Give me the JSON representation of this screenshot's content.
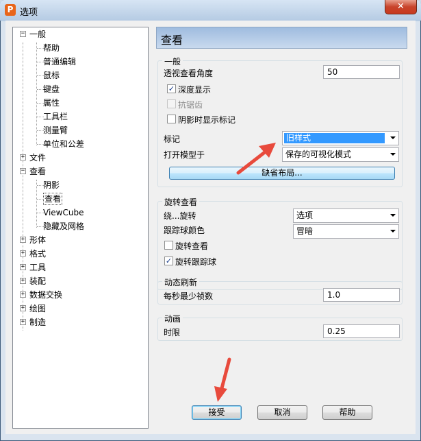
{
  "window": {
    "title": "选项",
    "app_icon_letter": "P",
    "close_glyph": "✕"
  },
  "tree": {
    "items": [
      {
        "label": "一般",
        "expander": "−"
      },
      {
        "label": "帮助"
      },
      {
        "label": "普通编辑"
      },
      {
        "label": "鼠标"
      },
      {
        "label": "键盘"
      },
      {
        "label": "属性"
      },
      {
        "label": "工具栏"
      },
      {
        "label": "测量臂"
      },
      {
        "label": "单位和公差"
      },
      {
        "label": "文件",
        "expander": "+"
      },
      {
        "label": "查看",
        "expander": "−"
      },
      {
        "label": "阴影"
      },
      {
        "label": "查看"
      },
      {
        "label": "ViewCube"
      },
      {
        "label": "隐藏及网格"
      },
      {
        "label": "形体",
        "expander": "+"
      },
      {
        "label": "格式",
        "expander": "+"
      },
      {
        "label": "工具",
        "expander": "+"
      },
      {
        "label": "装配",
        "expander": "+"
      },
      {
        "label": "数据交换",
        "expander": "+"
      },
      {
        "label": "绘图",
        "expander": "+"
      },
      {
        "label": "制造",
        "expander": "+"
      }
    ]
  },
  "panel": {
    "title": "查看",
    "general": {
      "title": "一般",
      "perspective_label": "透视查看角度",
      "perspective_value": "50",
      "depth_display_label": "深度显示",
      "depth_display_checked": true,
      "antialias_label": "抗锯齿",
      "antialias_checked": false,
      "shadow_marker_label": "阴影时显示标记",
      "shadow_marker_checked": false,
      "marker_label": "标记",
      "marker_value": "旧样式",
      "open_model_label": "打开模型于",
      "open_model_value": "保存的可视化模式",
      "default_layout_button": "缺省布局..."
    },
    "rotate": {
      "title": "旋转查看",
      "around_label": "绕...旋转",
      "around_value": "选项",
      "trackball_color_label": "跟踪球颜色",
      "trackball_color_value": "冒暗",
      "rotate_view_label": "旋转查看",
      "rotate_view_checked": false,
      "rotate_trackball_label": "旋转跟踪球",
      "rotate_trackball_checked": true
    },
    "refresh": {
      "title": "动态刷新",
      "min_fps_label": "每秒最少祯数",
      "min_fps_value": "1.0"
    },
    "animation": {
      "title": "动画",
      "duration_label": "时限",
      "duration_value": "0.25"
    }
  },
  "footer": {
    "accept_button": "接受",
    "cancel_button": "取消",
    "help_button": "帮助"
  },
  "colors": {
    "annotation_arrow": "#e84a3c",
    "selection": "#3399ff"
  }
}
